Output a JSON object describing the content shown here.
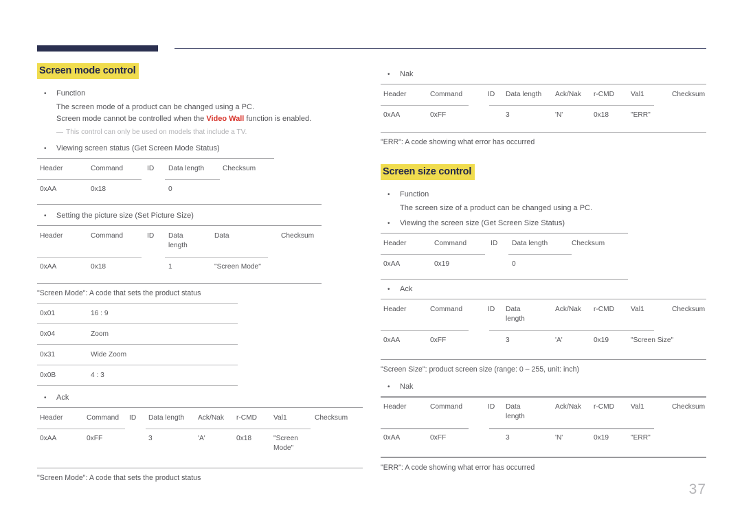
{
  "page": {
    "number": "37"
  },
  "left": {
    "heading": "Screen mode control",
    "function_bullet": "Function",
    "function_line1": "The screen mode of a product can be changed using a PC.",
    "function_line2_pre": "Screen mode cannot be controlled when the ",
    "function_line2_em": "Video Wall",
    "function_line2_post": " function is enabled.",
    "note": "This control can only be used on models that include a TV.",
    "get_bullet": "Viewing screen status (Get Screen Mode Status)",
    "get_table": {
      "headers": [
        "Header",
        "Command",
        "ID",
        "Data length",
        "Checksum"
      ],
      "values": [
        "0xAA",
        "0x18",
        "",
        "0",
        ""
      ]
    },
    "set_bullet": "Setting the picture size (Set Picture Size)",
    "set_table": {
      "headers": [
        "Header",
        "Command",
        "ID",
        "Data\nlength",
        "Data",
        "Checksum"
      ],
      "values": [
        "0xAA",
        "0x18",
        "",
        "1",
        "\"Screen Mode\"",
        ""
      ]
    },
    "code_caption": "\"Screen Mode\": A code that sets the product status",
    "code_table": {
      "rows": [
        [
          "0x01",
          "16 : 9"
        ],
        [
          "0x04",
          "Zoom"
        ],
        [
          "0x31",
          "Wide Zoom"
        ],
        [
          "0x0B",
          "4 : 3"
        ]
      ]
    },
    "ack_bullet": "Ack",
    "ack_table": {
      "headers": [
        "Header",
        "Command",
        "ID",
        "Data length",
        "Ack/Nak",
        "r-CMD",
        "Val1",
        "Checksum"
      ],
      "values": [
        "0xAA",
        "0xFF",
        "",
        "3",
        "'A'",
        "0x18",
        "\"Screen\nMode\"",
        ""
      ]
    },
    "ack_caption": "\"Screen Mode\": A code that sets the product status"
  },
  "right": {
    "nak_bullet_top": "Nak",
    "nak_table_top": {
      "headers": [
        "Header",
        "Command",
        "ID",
        "Data length",
        "Ack/Nak",
        "r-CMD",
        "Val1",
        "Checksum"
      ],
      "values": [
        "0xAA",
        "0xFF",
        "",
        "3",
        "'N'",
        "0x18",
        "\"ERR\"",
        ""
      ]
    },
    "nak_caption_top": "\"ERR\": A code showing what error has occurred",
    "heading": "Screen size control",
    "function_bullet": "Function",
    "function_line1": "The screen size of a product can be changed using a PC.",
    "get_bullet": "Viewing the screen size (Get Screen Size Status)",
    "get_table": {
      "headers": [
        "Header",
        "Command",
        "ID",
        "Data length",
        "Checksum"
      ],
      "values": [
        "0xAA",
        "0x19",
        "",
        "0",
        ""
      ]
    },
    "ack_bullet": "Ack",
    "ack_table": {
      "headers": [
        "Header",
        "Command",
        "ID",
        "Data\nlength",
        "Ack/Nak",
        "r-CMD",
        "Val1",
        "Checksum"
      ],
      "values": [
        "0xAA",
        "0xFF",
        "",
        "3",
        "'A'",
        "0x19",
        "\"Screen Size\"",
        ""
      ]
    },
    "ack_caption": "\"Screen Size\": product screen size (range: 0 – 255, unit: inch)",
    "nak_bullet": "Nak",
    "nak_table": {
      "headers": [
        "Header",
        "Command",
        "ID",
        "Data\nlength",
        "Ack/Nak",
        "r-CMD",
        "Val1",
        "Checksum"
      ],
      "values": [
        "0xAA",
        "0xFF",
        "",
        "3",
        "'N'",
        "0x19",
        "\"ERR\"",
        ""
      ]
    },
    "nak_caption": "\"ERR\": A code showing what error has occurred"
  }
}
